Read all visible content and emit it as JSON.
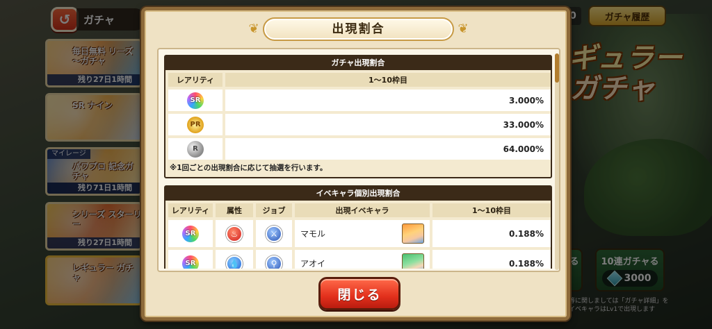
{
  "background": {
    "top_title": "ガチャ",
    "history_button": "ガチャ履歴",
    "right_stub": "0",
    "banner_title_line1": "ギュラー",
    "banner_title_line2": "ガチャ",
    "gacha_list": [
      {
        "caption": "毎日無料 リーズ 〜ガチャ",
        "tag": "",
        "remain": "残り27日1時間"
      },
      {
        "caption": "SR ナイン",
        "tag": "",
        "remain": ""
      },
      {
        "caption": "パワプロ 記念ガチャ",
        "tag": "マイレージ",
        "remain": "残り71日1時間"
      },
      {
        "caption": "シリーズ スターリー",
        "tag": "",
        "remain": "残り27日1時間"
      },
      {
        "caption": "レギュラー ガチャ",
        "tag": "",
        "remain": ""
      }
    ],
    "ten_pull_label": "10連ガチャる",
    "ten_pull_cost": "3000",
    "single_pull_label": "る",
    "bottom_note": "等に関しましては「ガチャ詳細」を イベキャラはLv1で出現します"
  },
  "modal": {
    "title": "出現割合",
    "close_label": "閉じる",
    "gacha_rates": {
      "heading": "ガチャ出現割合",
      "columns": [
        "レアリティ",
        "1〜10枠目"
      ],
      "rows": [
        {
          "rarity": "SR",
          "rarity_icon": "rarity-sr-icon",
          "rate": "3.000%"
        },
        {
          "rarity": "PR",
          "rarity_icon": "rarity-pr-icon",
          "rate": "33.000%"
        },
        {
          "rarity": "R",
          "rarity_icon": "rarity-r-icon",
          "rate": "64.000%"
        }
      ],
      "note": "※1回ごとの出現割合に応じて抽選を行います。"
    },
    "event_chara_rates": {
      "heading": "イベキャラ個別出現割合",
      "columns": [
        "レアリティ",
        "属性",
        "ジョブ",
        "出現イベキャラ",
        "1〜10枠目"
      ],
      "rows": [
        {
          "rarity": "SR",
          "attribute_icon": "fire-attribute-icon",
          "job_icon": "sword-job-icon",
          "name": "マモル",
          "rate": "0.188%"
        },
        {
          "rarity": "SR",
          "attribute_icon": "water-attribute-icon",
          "job_icon": "wand-job-icon",
          "name": "アオイ",
          "rate": "0.188%"
        }
      ]
    }
  },
  "colors": {
    "modal_frame": "#8d6a3a",
    "section_header": "#3b2a18",
    "close_button": "#e2301c",
    "accent_gold": "#c79a45"
  }
}
